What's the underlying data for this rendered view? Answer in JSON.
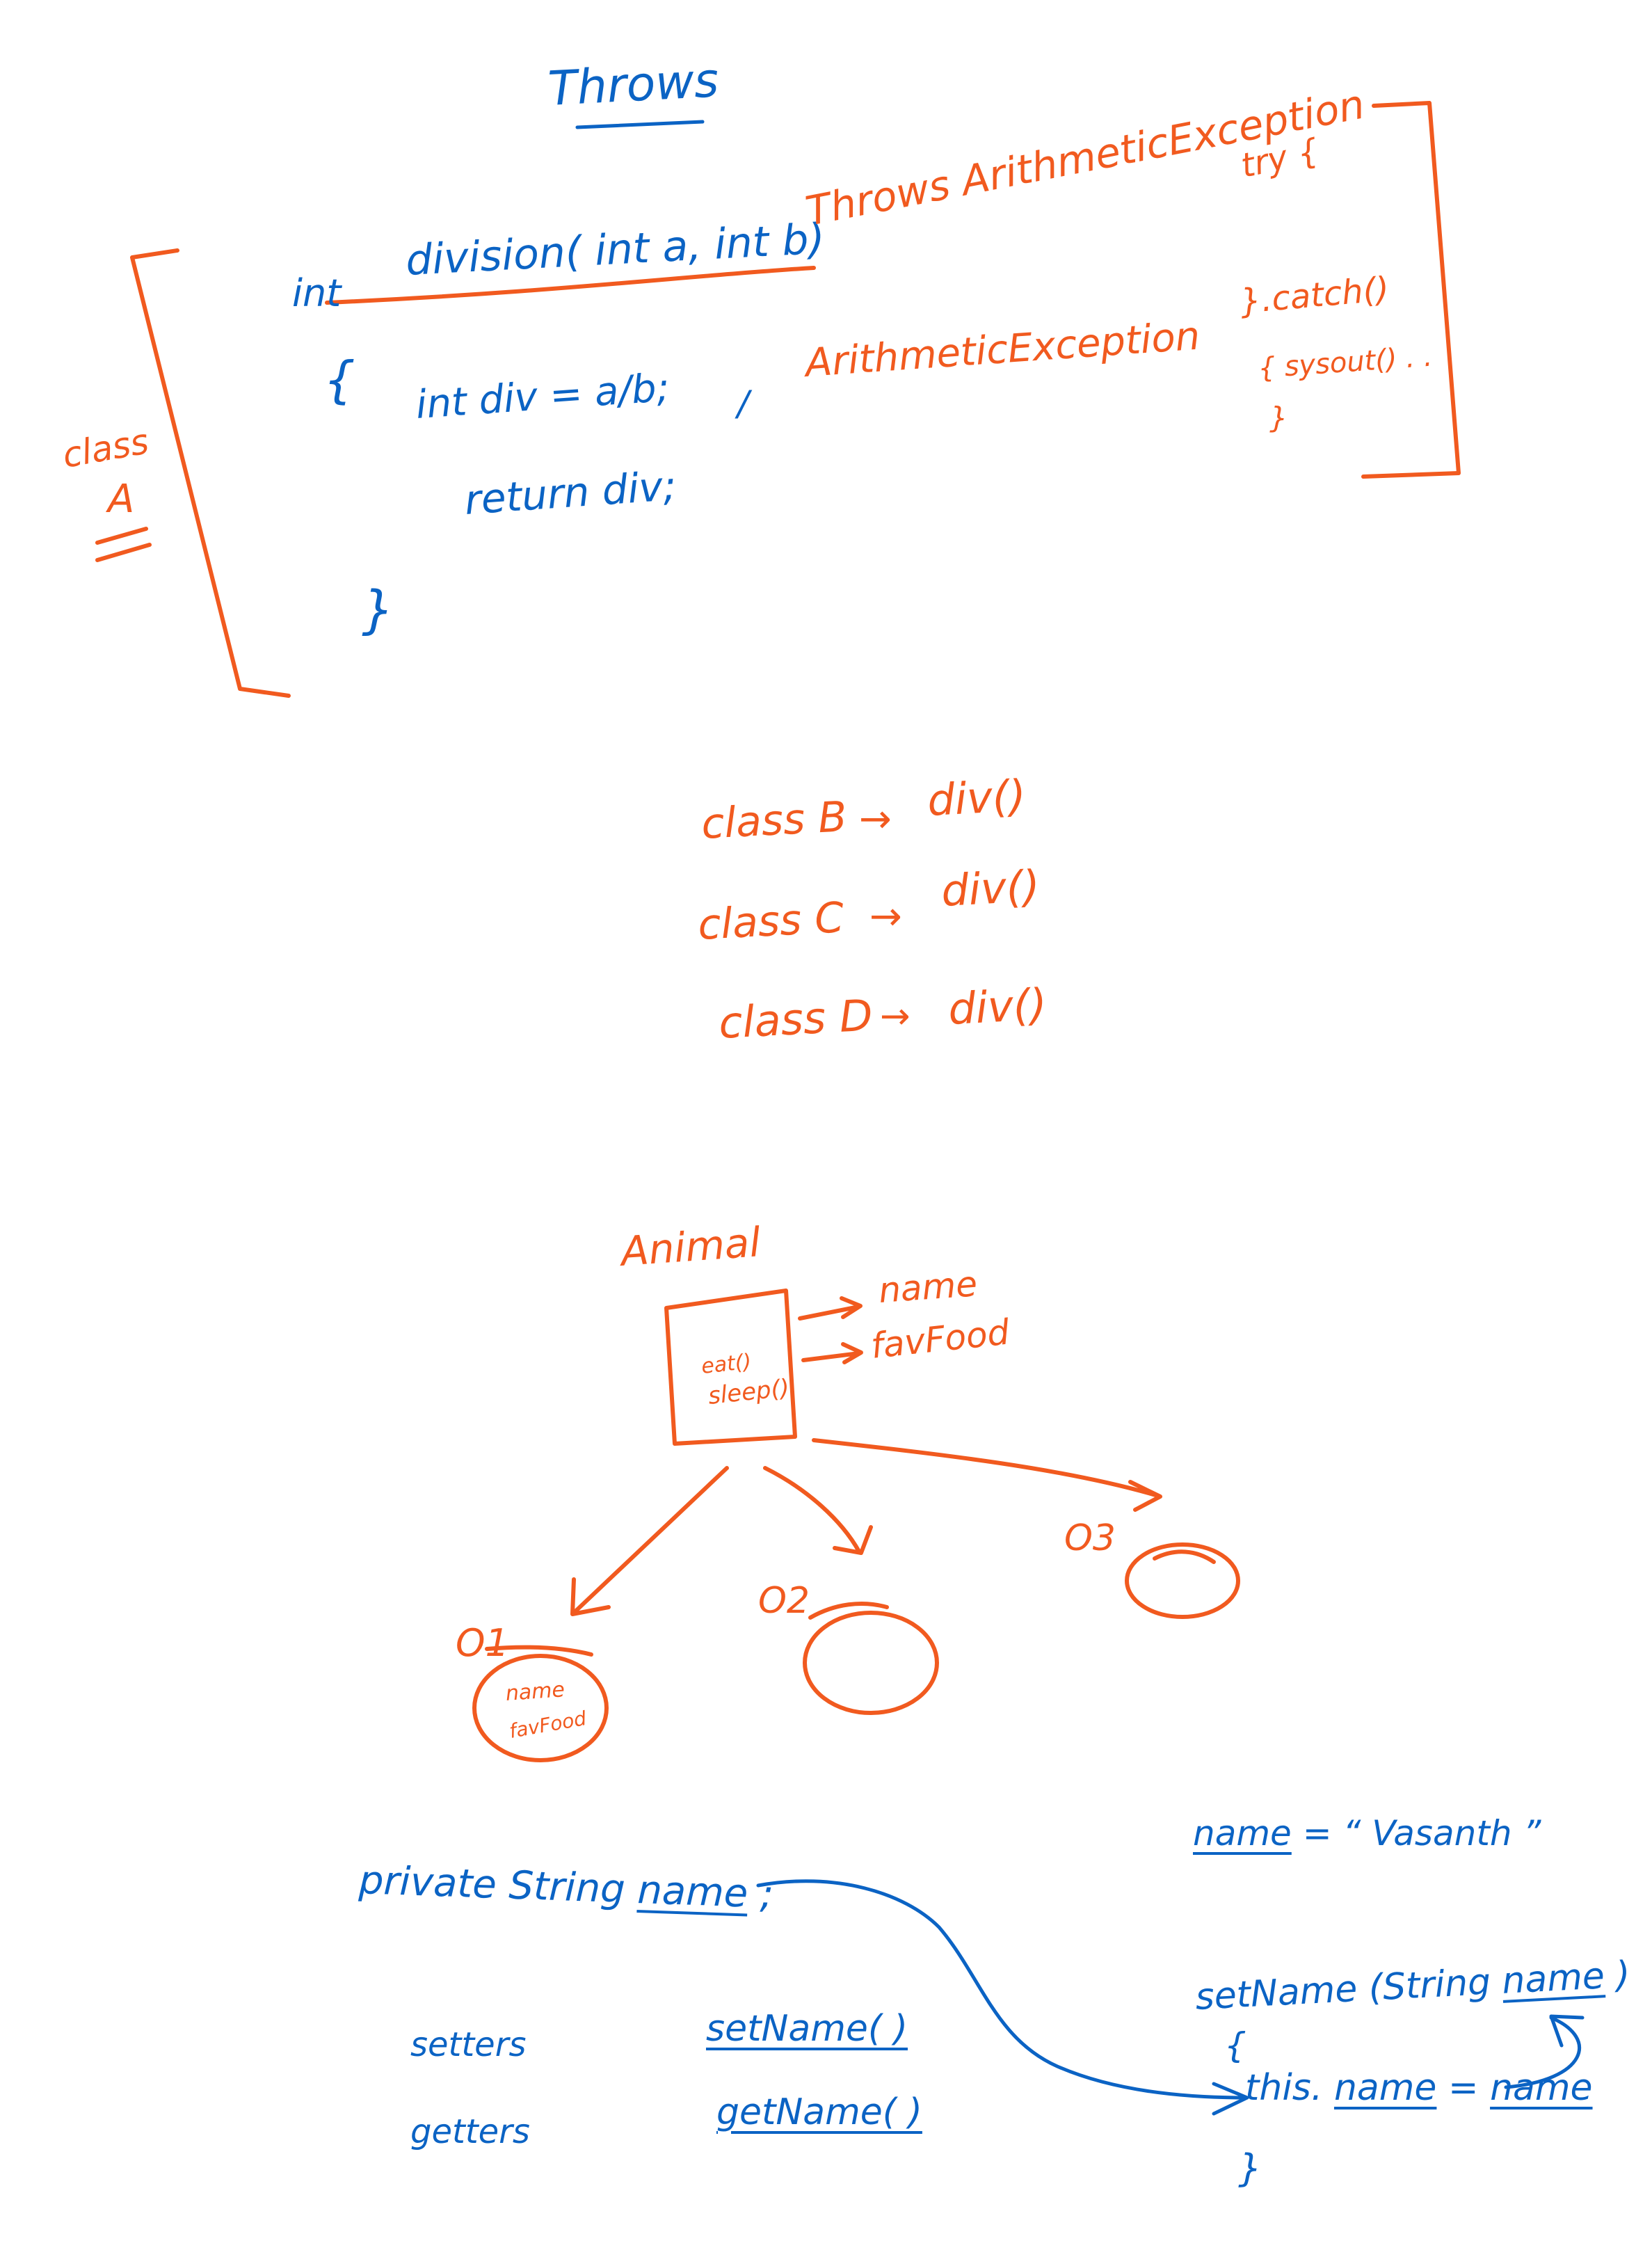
{
  "colors": {
    "blue_ink": "#0b63c4",
    "orange_ink": "#f15a1f",
    "background": "#ffffff"
  },
  "section_throws": {
    "title": "Throws",
    "signature_int": "int",
    "signature_rest": "division( int a,  int b)",
    "throws_clause": "Throws ArithmeticException",
    "try_label": "try {",
    "catch_label": "}.catch()",
    "catch_open": "{  sysout() . .",
    "catch_close": "}",
    "open_brace": "{",
    "body_line1": "int div = a/b;",
    "slash_mark": "/",
    "exception_note": "ArithmeticException",
    "body_line2": "return div;",
    "close_brace": "}",
    "class_label_1": "class",
    "class_label_2": "A"
  },
  "class_calls": [
    {
      "cls": "class B",
      "arrow": "→",
      "call": "div()"
    },
    {
      "cls": "class C",
      "arrow": "→",
      "call": "div()"
    },
    {
      "cls": "class D",
      "arrow": "→",
      "call": "div()"
    }
  ],
  "animal_diagram": {
    "title": "Animal",
    "methods": [
      "eat()",
      "sleep()"
    ],
    "fields": [
      "name",
      "favFood"
    ],
    "objects": [
      {
        "label": "O1",
        "contents": [
          "name",
          "favFood"
        ]
      },
      {
        "label": "O2",
        "contents": []
      },
      {
        "label": "O3",
        "contents": []
      }
    ]
  },
  "encapsulation": {
    "declaration_prefix": "private String",
    "declaration_name": "name",
    "declaration_suffix": ";",
    "setters_label": "setters",
    "getters_label": "getters",
    "setter_method": "setName( )",
    "getter_method": "getName( )",
    "assign_name": "name",
    "assign_rest": "=   “ Vasanth ”",
    "setname_sig_prefix": "setName (String",
    "setname_sig_param": "name",
    "setname_sig_suffix": ")",
    "body_open": "{",
    "this_prefix": "this.",
    "this_name": "name",
    "this_eq": "=",
    "this_value": "name",
    "body_close": "}"
  }
}
